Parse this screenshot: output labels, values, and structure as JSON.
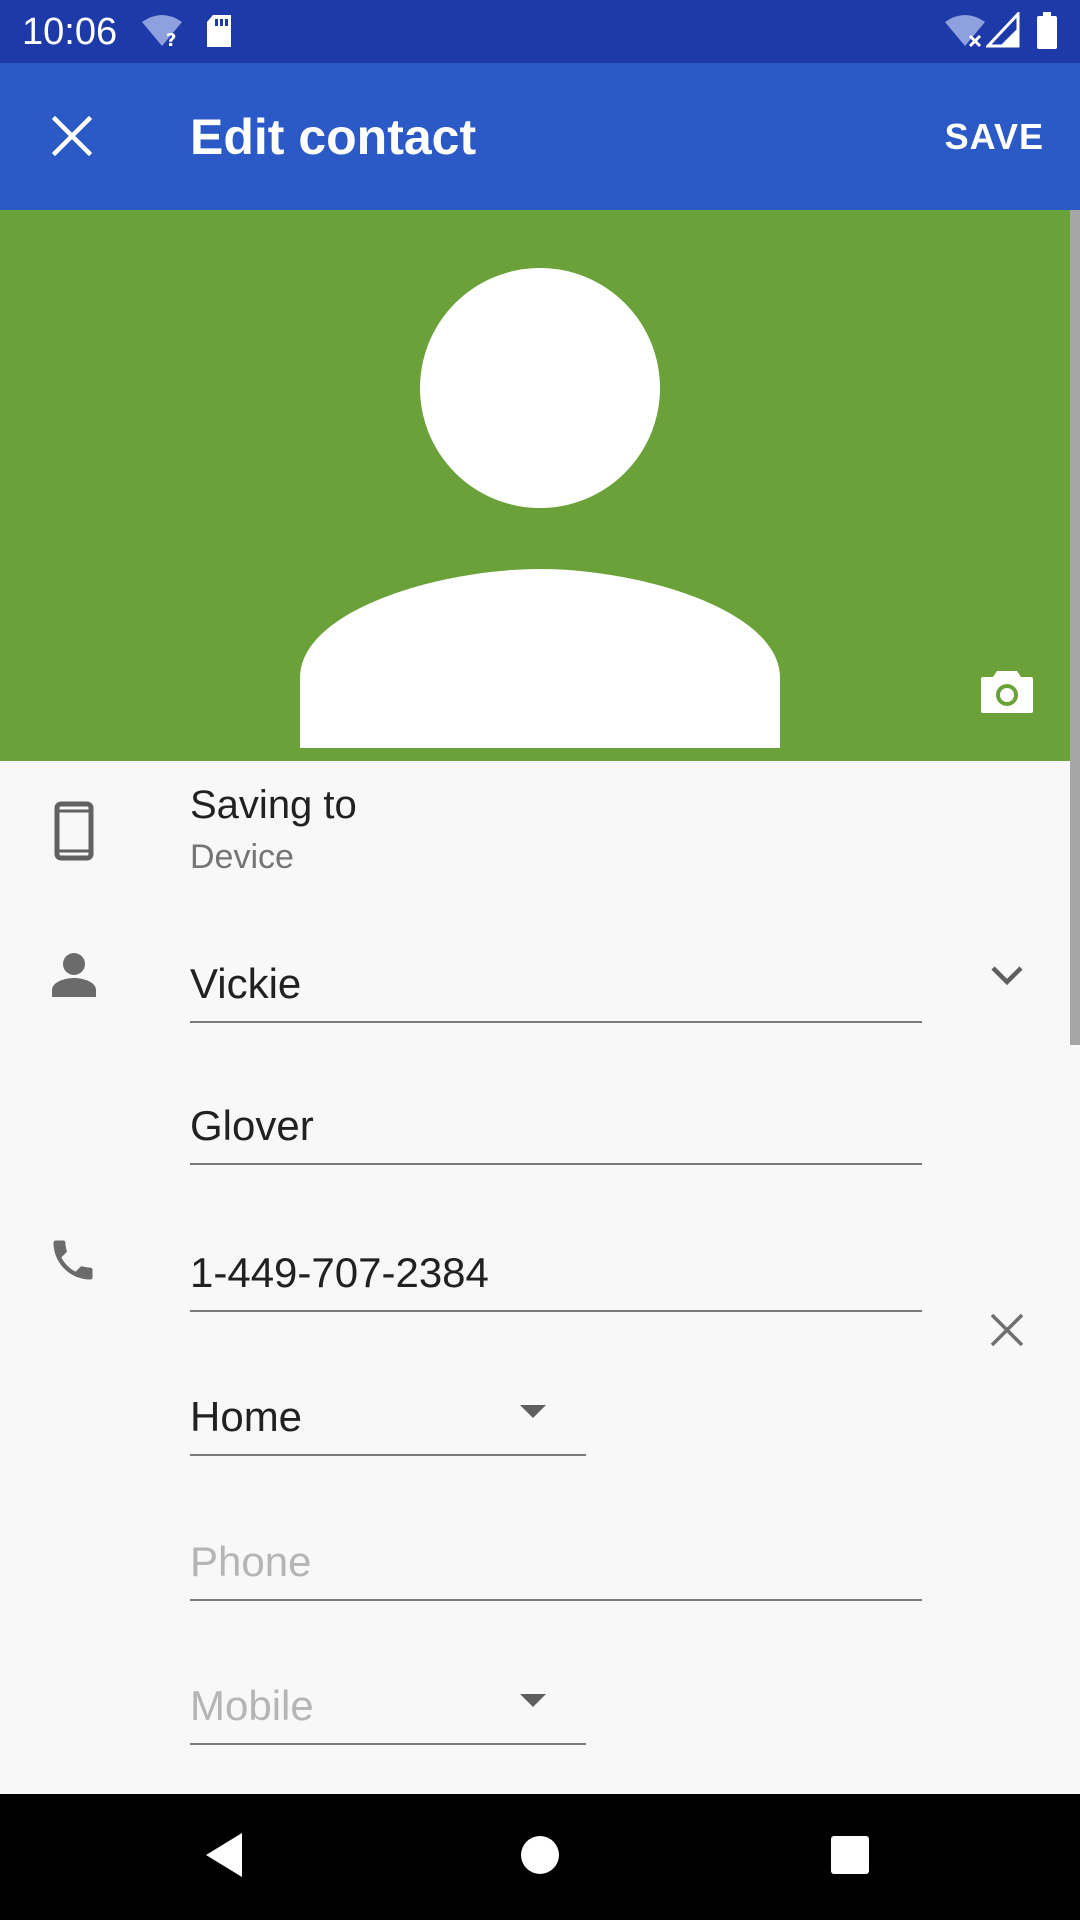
{
  "status_bar": {
    "time": "10:06",
    "icons": [
      "wifi-question-icon",
      "sd-card-icon",
      "wifi-off-icon",
      "signal-icon",
      "battery-icon"
    ]
  },
  "app_bar": {
    "close_icon": "close-icon",
    "title": "Edit contact",
    "save_label": "SAVE",
    "color": "#2b59c6"
  },
  "photo": {
    "background": "#6aa139",
    "camera_icon": "camera-icon"
  },
  "saving_to": {
    "icon": "phone-device-icon",
    "title": "Saving to",
    "account": "Device"
  },
  "name": {
    "icon": "person-icon",
    "first_name": "Vickie",
    "last_name": "Glover",
    "expand_icon": "chevron-down-icon"
  },
  "phone": {
    "icon": "phone-icon",
    "number": "1-449-707-2384",
    "type": "Home",
    "remove_icon": "close-icon",
    "new_phone_placeholder": "Phone",
    "new_phone_type_placeholder": "Mobile"
  },
  "nav_bar": {
    "buttons": [
      "back-icon",
      "home-icon",
      "recents-icon"
    ]
  }
}
